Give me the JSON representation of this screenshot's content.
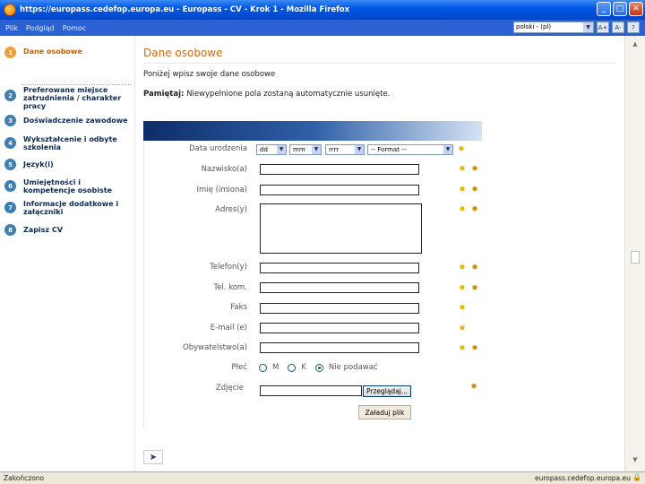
{
  "window": {
    "title": "https://europass.cedefop.europa.eu - Europass - CV - Krok 1 - Mozilla Firefox",
    "buttons": {
      "minimize": "_",
      "maximize": "□",
      "close": "✕"
    }
  },
  "menubar": {
    "items": [
      "Plik",
      "Podgląd",
      "Pomoc"
    ],
    "language": "polski - (pl)",
    "font_plus": "A+",
    "font_minus": "A-",
    "help": "?"
  },
  "sidebar": {
    "steps": [
      {
        "number": "1",
        "label": "Dane osobowe"
      },
      {
        "number": "2",
        "label": "Preferowane miejsce zatrudnienia / charakter pracy"
      },
      {
        "number": "3",
        "label": "Doświadczenie zawodowe"
      },
      {
        "number": "4",
        "label": "Wykształcenie i odbyte szkolenia"
      },
      {
        "number": "5",
        "label": "Język(i)"
      },
      {
        "number": "6",
        "label": "Umiejętności i kompetencje osobiste"
      },
      {
        "number": "7",
        "label": "Informacje dodatkowe i załączniki"
      },
      {
        "number": "8",
        "label": "Zapisz CV"
      }
    ]
  },
  "main": {
    "title": "Dane osobowe",
    "intro": "Poniżej wpisz swoje dane osobowe",
    "note_bold": "Pamiętaj:",
    "note_text": "Niewypełnione pola zostaną automatycznie usunięte."
  },
  "form": {
    "birth_date_label": "Data urodzenia",
    "day": "dd",
    "month": "mm",
    "year": "rrrr",
    "format": "-- Format --",
    "surname_label": "Nazwisko(a)",
    "firstname_label": "Imię (imiona)",
    "address_label": "Adres(y)",
    "phone_label": "Telefon(y)",
    "mobile_label": "Tel. kom.",
    "fax_label": "Faks",
    "email_label": "E-mail (e)",
    "nationality_label": "Obywatelstwo(a)",
    "gender_label": "Płeć",
    "gender_options": [
      "M",
      "K",
      "Nie podawać"
    ],
    "gender_selected": "Nie podawać",
    "photo_label": "Zdjęcie",
    "browse_button": "Przeglądaj...",
    "upload_button": "Załaduj plik"
  },
  "next_arrow": "➤",
  "status": {
    "left": "Zakończono",
    "right": "europass.cedefop.europa.eu"
  }
}
